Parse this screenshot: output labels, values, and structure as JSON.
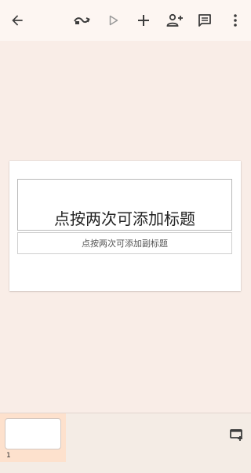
{
  "toolbar": {
    "icons": [
      "arrow-back-icon",
      "presenter-icon",
      "play-icon",
      "plus-icon",
      "person-add-icon",
      "comment-icon",
      "more-vert-icon"
    ]
  },
  "slide": {
    "title_placeholder": "点按两次可添加标题",
    "subtitle_placeholder": "点按两次可添加副标题"
  },
  "filmstrip": {
    "slides": [
      {
        "number": "1"
      }
    ]
  },
  "colors": {
    "canvas_bg": "#f9ede7",
    "toolbar_bg": "#fdf6f2",
    "selected_thumb_bg": "#fde1cd",
    "icon_color": "#3c3c3c",
    "disabled_icon": "#9a9a9a"
  }
}
